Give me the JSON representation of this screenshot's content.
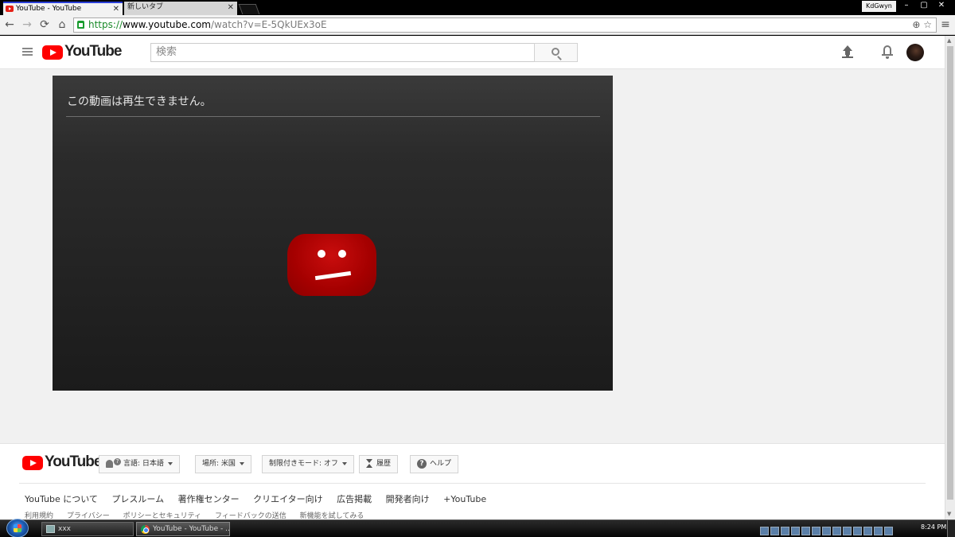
{
  "browser": {
    "tabs": [
      {
        "label": "YouTube - YouTube",
        "active": true
      },
      {
        "label": "新しいタブ",
        "active": false
      }
    ],
    "user": "KdGwyn",
    "window_buttons": [
      "–",
      "▢",
      "✕"
    ],
    "nav": {
      "back": "←",
      "forward": "→",
      "reload": "⟳",
      "home": "⌂"
    },
    "url": {
      "scheme": "https://",
      "host": "www.youtube.com",
      "path": "/watch?v=E-5QkUEx3oE"
    },
    "omnibox_icons": "⊕ ☆",
    "menu": "≡"
  },
  "masthead": {
    "logo_text": "YouTube",
    "search_placeholder": "検索"
  },
  "player": {
    "error_message": "この動画は再生できません。"
  },
  "footer": {
    "logo_text": "YouTube",
    "buttons": {
      "language": "言語: 日本語",
      "location": "場所: 米国",
      "restricted": "制限付きモード: オフ",
      "history": "履歴",
      "help": "ヘルプ"
    },
    "links_primary": [
      "YouTube について",
      "プレスルーム",
      "著作権センター",
      "クリエイター向け",
      "広告掲載",
      "開発者向け",
      "+YouTube"
    ],
    "links_secondary": [
      "利用規約",
      "プライバシー",
      "ポリシーとセキュリティ",
      "フィードバックの送信",
      "新機能を試してみる"
    ]
  },
  "taskbar": {
    "tasks": [
      {
        "label": "xxx"
      },
      {
        "label": "YouTube - YouTube - ..."
      }
    ],
    "clock": "8:24 PM"
  },
  "colors": {
    "brand_red": "#ff0000",
    "error_face": "#b30000",
    "active_tab_accent": "#2a3fd8"
  }
}
